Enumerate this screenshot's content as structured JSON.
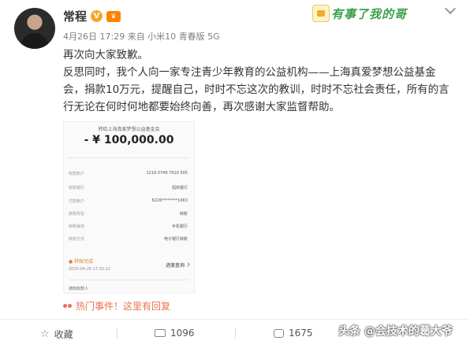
{
  "post": {
    "username": "常程",
    "verified_mark": "V",
    "vip_mark": "♛",
    "meta": "4月26日 17:29 来自 小米10 青春版 5G",
    "sticker": "有事了我的哥",
    "line1": "再次向大家致歉。",
    "line2": "反思同时，我个人向一家专注青少年教育的公益机构——上海真爱梦想公益基金会，捐款10万元，提醒自己，时时不忘这次的教训，时时不忘社会责任，所有的言行无论在何时何地都要始终向善，再次感谢大家监督帮助。"
  },
  "receipt": {
    "title": "转给上海真爱梦想公益基金会",
    "amount": "- ¥ 100,000.00",
    "rows": [
      {
        "k": "收款账户",
        "v": "1219 0749 7910 505"
      },
      {
        "k": "收款银行",
        "v": "招商银行"
      },
      {
        "k": "付款账户",
        "v": "6226********1663"
      },
      {
        "k": "转账附言",
        "v": "转账"
      },
      {
        "k": "转账渠道",
        "v": "手机银行"
      },
      {
        "k": "转账方式",
        "v": "电子银行转账"
      }
    ],
    "status": "● 转账完成",
    "status_date": "2020-04-26 17:22:22",
    "progress": "进度查询",
    "notify": "通知收款人"
  },
  "hot": {
    "text": "热门事件！这里有回复"
  },
  "actions": {
    "favorite": "收藏",
    "repost_count": "1096",
    "comment_count": "1675",
    "like_count": ""
  },
  "watermark": "头条 @会技术的葛大爷"
}
